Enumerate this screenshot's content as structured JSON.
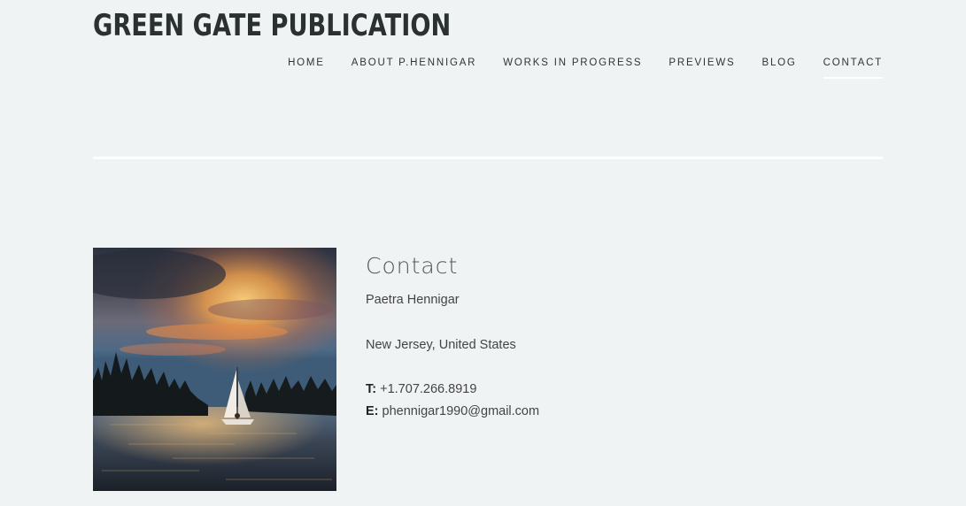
{
  "site": {
    "title": "GREEN GATE PUBLICATION"
  },
  "nav": {
    "items": [
      {
        "label": "HOME"
      },
      {
        "label": "ABOUT P.HENNIGAR"
      },
      {
        "label": "WORKS IN PROGRESS"
      },
      {
        "label": "PREVIEWS"
      },
      {
        "label": "BLOG"
      },
      {
        "label": "CONTACT",
        "active": true
      }
    ]
  },
  "contact": {
    "heading": "Contact",
    "name": "Paetra Hennigar",
    "location": "New Jersey, United States",
    "phone_label": "T:",
    "phone": "+1.707.266.8919",
    "email_label": "E:",
    "email": "phennigar1990@gmail.com"
  },
  "photo": {
    "icon": "sailboat-sunset-image"
  },
  "colors": {
    "background": "#f0f3f3",
    "title": "#2a3130",
    "divider": "#ffffff"
  }
}
